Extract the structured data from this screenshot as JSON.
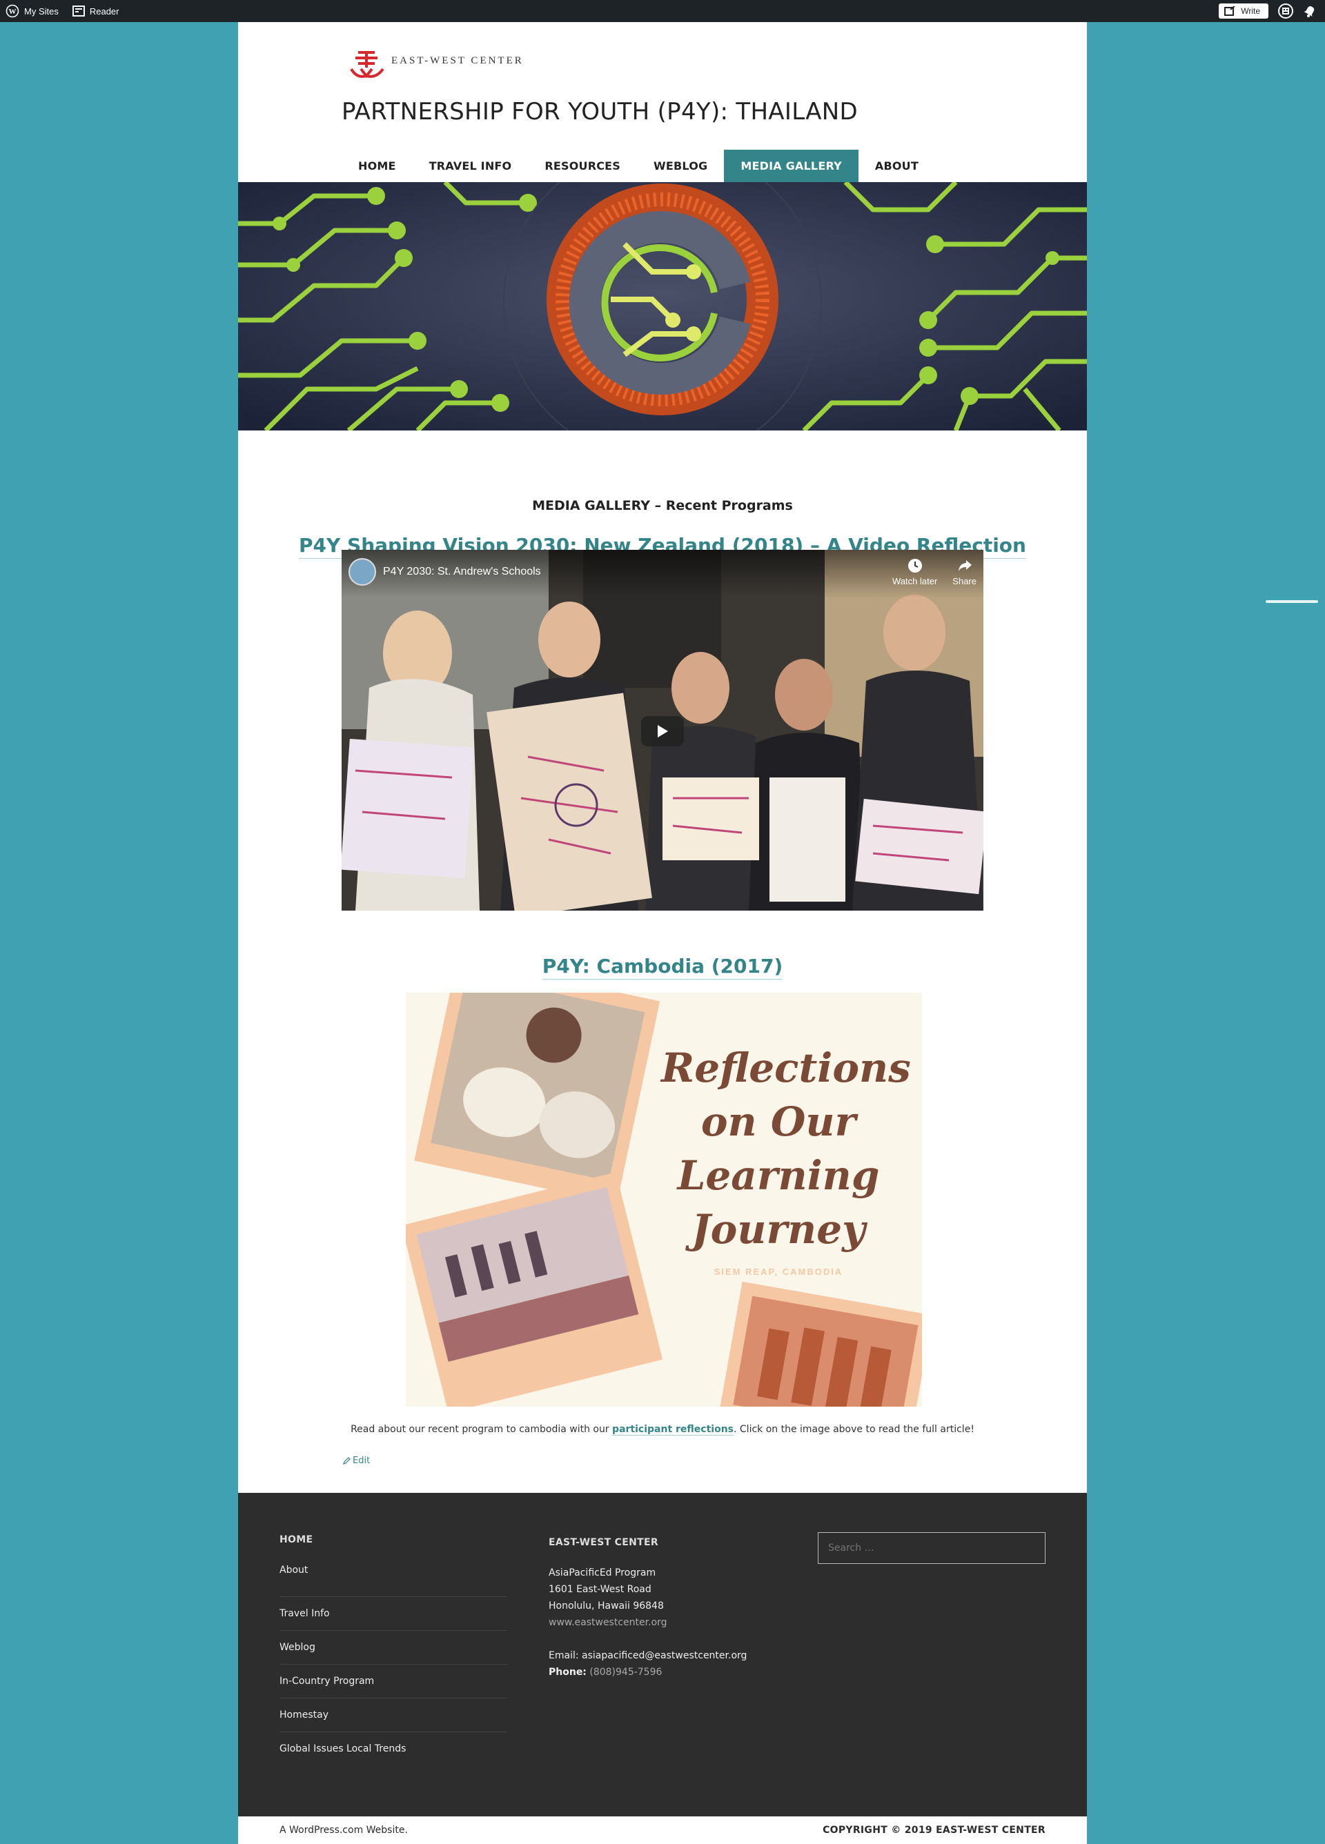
{
  "adminbar": {
    "my_sites": "My Sites",
    "reader": "Reader",
    "write": "Write"
  },
  "site": {
    "logo_text": "EAST-WEST CENTER",
    "title": "PARTNERSHIP FOR YOUTH (P4Y): THAILAND"
  },
  "nav": {
    "items": [
      "HOME",
      "TRAVEL INFO",
      "RESOURCES",
      "WEBLOG",
      "MEDIA GALLERY",
      "ABOUT"
    ],
    "active": "MEDIA GALLERY"
  },
  "content": {
    "section_heading": "MEDIA GALLERY – Recent Programs",
    "post1_title": "P4Y Shaping Vision 2030: New Zealand (2018) – A Video Reflection",
    "video": {
      "title": "P4Y 2030: St. Andrew's Schools",
      "watch_later": "Watch later",
      "share": "Share"
    },
    "post2_title": "P4Y: Cambodia (2017)",
    "poster": {
      "line1": "Reflections",
      "line2": "on Our",
      "line3": "Learning",
      "line4": "Journey",
      "subtitle": "SIEM REAP, CAMBODIA"
    },
    "body_before": "Read about our recent program to cambodia with our ",
    "body_link": "participant reflections",
    "body_after": ". Click on the image above to read the full article!",
    "edit": "Edit"
  },
  "footer": {
    "col1": {
      "heading": "HOME",
      "links": [
        "About",
        "Travel Info",
        "Weblog",
        "In-Country Program",
        "Homestay",
        "Global Issues Local Trends"
      ]
    },
    "col2": {
      "heading": "EAST-WEST CENTER",
      "program": "AsiaPacificEd Program",
      "address1": "1601 East-West Road",
      "address2": "Honolulu, Hawaii 96848",
      "website": "www.eastwestcenter.org",
      "email": "Email: asiapacificed@eastwestcenter.org",
      "phone_label": "Phone:",
      "phone": "(808)945-7596"
    },
    "search_placeholder": "Search …"
  },
  "bottom": {
    "left": "A WordPress.com Website.",
    "right": "COPYRIGHT © 2019 EAST-WEST CENTER"
  },
  "colors": {
    "background": "#3fa1b2",
    "accent": "#33858a",
    "footer": "#2d2d2d",
    "adminbar": "#1d2327"
  }
}
